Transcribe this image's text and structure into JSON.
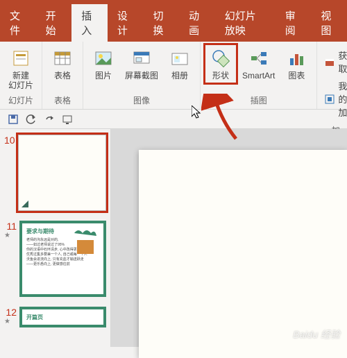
{
  "tabs": {
    "file": "文件",
    "home": "开始",
    "insert": "插入",
    "design": "设计",
    "transitions": "切换",
    "animations": "动画",
    "slideshow": "幻灯片放映",
    "review": "审阅",
    "view": "视图"
  },
  "ribbon": {
    "new_slide": "新建\n幻灯片",
    "table": "表格",
    "pictures": "图片",
    "screenshot": "屏幕截图",
    "album": "相册",
    "shapes": "形状",
    "smartart": "SmartArt",
    "chart": "图表",
    "get_addins": "获取",
    "my_addins": "我的加",
    "group_slides": "幻灯片",
    "group_tables": "表格",
    "group_images": "图像",
    "group_illustrations": "插图",
    "group_addins": "加"
  },
  "slides": {
    "s10_num": "10",
    "s11_num": "11",
    "s12_num": "12",
    "s11_title": "要求与期待",
    "s12_title": "开篇页",
    "s11_body": "老师的沟永远是对的,\n——如过老师说过了95%\n你的汉语中石环清步, 心中改得更好这步,\n优秀过集多要兼一个人, 自己或每一个人\n沃鱼会进流向上, 只有充血才输送跃走\n——更乐悉向上, 更做感往前"
  },
  "watermark": "Baidu 经验"
}
